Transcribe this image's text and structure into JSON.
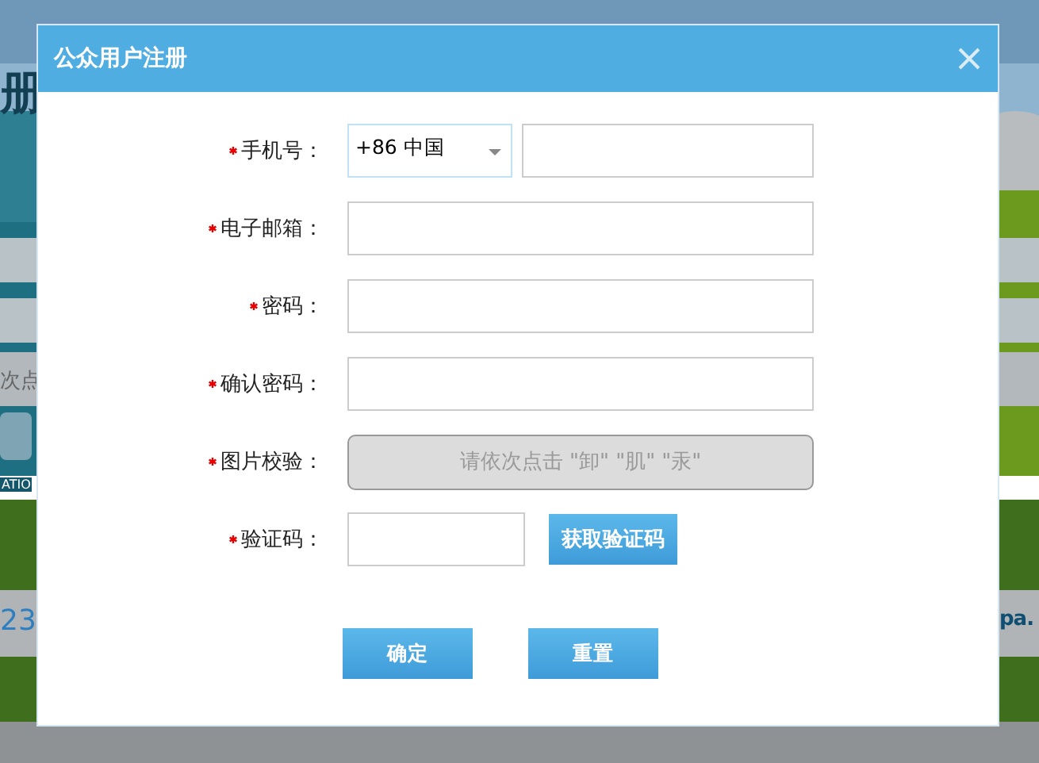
{
  "background_page": {
    "fragments": [
      {
        "kind": "banner",
        "text": "册"
      },
      {
        "kind": "hint",
        "text": "次点"
      },
      {
        "kind": "caption",
        "text": "ATIO"
      },
      {
        "kind": "number",
        "text": "23"
      },
      {
        "kind": "link",
        "text": "pa."
      }
    ]
  },
  "dialog": {
    "title": "公众用户注册",
    "fields": [
      {
        "kind": "phone",
        "label": "手机号：",
        "required": true,
        "country": "+86 中国"
      },
      {
        "kind": "text",
        "label": "电子邮箱：",
        "required": true
      },
      {
        "kind": "password",
        "label": "密码：",
        "required": true
      },
      {
        "kind": "password",
        "label": "确认密码：",
        "required": true
      },
      {
        "kind": "captcha",
        "label": "图片校验：",
        "required": true,
        "prompt": "请依次点击 \"卸\" \"肌\" \"汞\""
      },
      {
        "kind": "sms",
        "label": "验证码：",
        "required": true,
        "button": "获取验证码"
      }
    ],
    "buttons": [
      "确定",
      "重置"
    ]
  }
}
